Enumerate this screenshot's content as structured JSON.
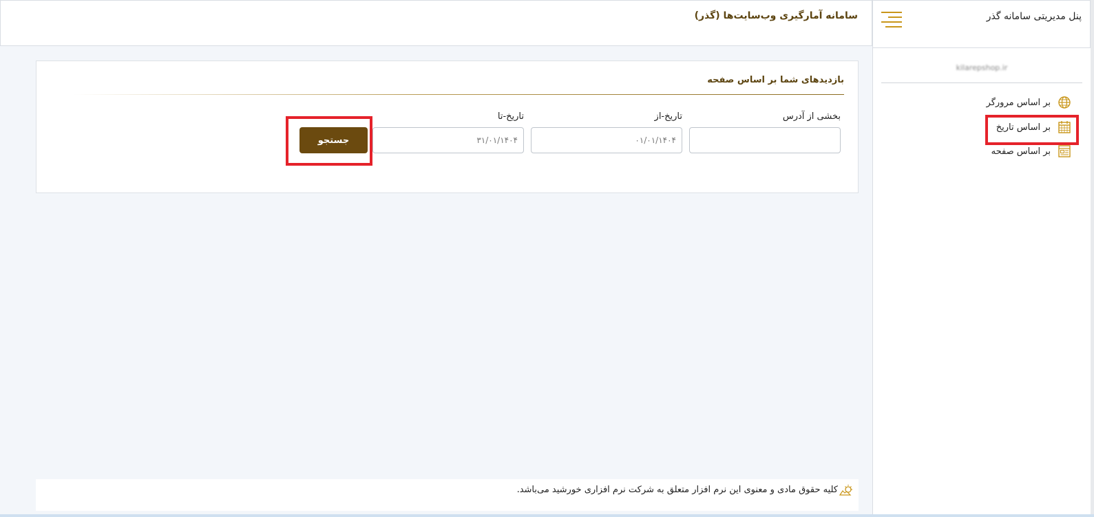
{
  "header": {
    "brand_title": "پنل مدیریتی سامانه گذر",
    "system_title": "سامانه آمارگیری وب‌سایت‌ها (گذر)"
  },
  "sidebar": {
    "site_domain": "kilarepshop.ir",
    "items": [
      {
        "label": "بر اساس مرورگر",
        "icon": "globe-icon"
      },
      {
        "label": "بر اساس تاریخ",
        "icon": "calendar-icon"
      },
      {
        "label": "بر اساس صفحه",
        "icon": "page-icon"
      }
    ]
  },
  "main": {
    "card_title": "بازدیدهای شما بر اساس صفحه",
    "address_label": "بخشی از آدرس",
    "address_value": "",
    "date_from_label": "تاریخ-از",
    "date_from_placeholder": "۰۱/۰۱/۱۴۰۴",
    "date_to_label": "تاریخ-تا",
    "date_to_placeholder": "۳۱/۰۱/۱۴۰۴",
    "search_label": "جستجو"
  },
  "footer": {
    "copyright": "کلیه حقوق مادی و معنوی این نرم افزار متعلق به شرکت نرم افزاری خورشید می‌باشد."
  },
  "colors": {
    "accent": "#c9961a",
    "brand_brown": "#5c4410",
    "button": "#6b4a0f",
    "highlight": "#e5222a"
  }
}
